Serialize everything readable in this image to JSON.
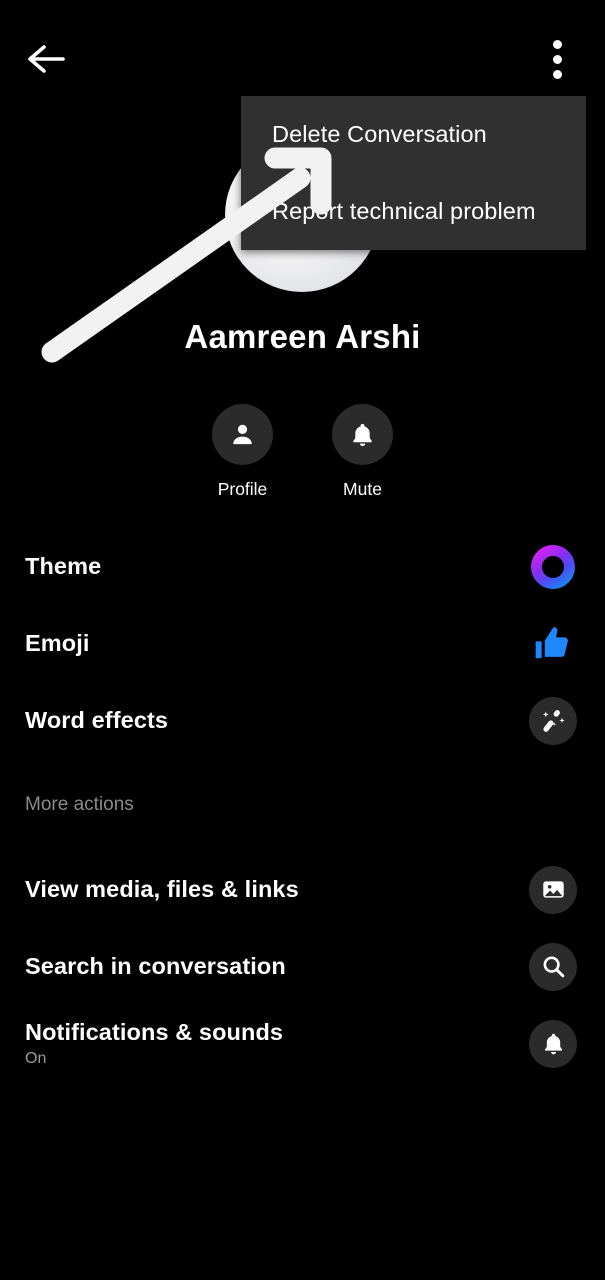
{
  "app": {
    "background_color": "#000000",
    "accent_blue": "#1e86ff",
    "menu_background": "#303030",
    "icon_circle": "#2b2b2b",
    "muted_text": "#8a8a8a"
  },
  "topbar": {
    "back_icon": "arrow-left-icon",
    "overflow_icon": "more-vertical-icon"
  },
  "popup_menu": {
    "visible": true,
    "items": [
      {
        "label": "Delete Conversation"
      },
      {
        "label": "Report technical problem"
      }
    ]
  },
  "annotation": {
    "type": "arrow",
    "color": "#f4f4f4",
    "points_to": "Delete Conversation"
  },
  "profile": {
    "name": "Aamreen Arshi",
    "avatar_icon": "avatar-placeholder"
  },
  "quick_actions": [
    {
      "label": "Profile",
      "icon": "person-icon"
    },
    {
      "label": "Mute",
      "icon": "bell-icon"
    }
  ],
  "customization_rows": [
    {
      "title": "Theme",
      "subtitle": "",
      "icon": "theme-ring-icon",
      "icon_style": "plain",
      "icon_color_from": "#c026ff",
      "icon_color_to": "#2a6cff"
    },
    {
      "title": "Emoji",
      "subtitle": "",
      "icon": "thumbs-up-icon",
      "icon_style": "plain",
      "icon_color": "#1e86ff"
    },
    {
      "title": "Word effects",
      "subtitle": "",
      "icon": "magic-wand-icon",
      "icon_style": "dark"
    }
  ],
  "more_actions": {
    "section_label": "More actions",
    "rows": [
      {
        "title": "View media, files & links",
        "subtitle": "",
        "icon": "image-icon",
        "icon_style": "dark"
      },
      {
        "title": "Search in conversation",
        "subtitle": "",
        "icon": "search-icon",
        "icon_style": "dark"
      },
      {
        "title": "Notifications & sounds",
        "subtitle": "On",
        "icon": "bell-icon",
        "icon_style": "dark"
      }
    ]
  }
}
